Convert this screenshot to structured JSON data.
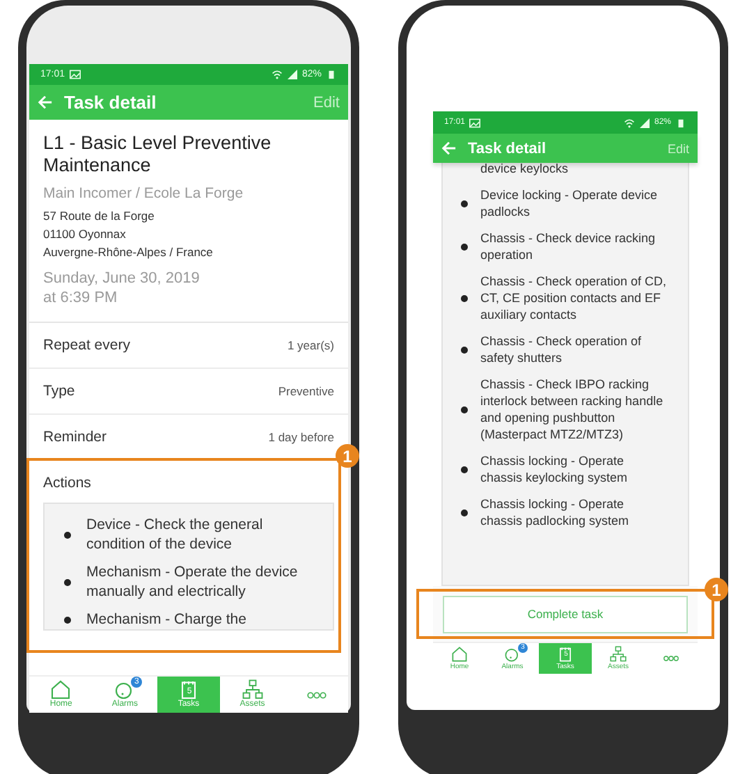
{
  "phones": [
    {
      "status_bar": {
        "time": "17:01",
        "battery": "82%"
      },
      "header": {
        "title": "Task detail",
        "action": "Edit"
      },
      "task": {
        "title": "L1 - Basic Level Preventive Maintenance",
        "location": "Main Incomer / Ecole La Forge",
        "address": [
          "57 Route de la Forge",
          "01100 Oyonnax",
          "Auvergne-Rhône-Alpes / France"
        ],
        "date": [
          "Sunday, June 30, 2019",
          "at 6:39 PM"
        ]
      },
      "details": [
        {
          "label": "Repeat every",
          "value": "1 year(s)"
        },
        {
          "label": "Type",
          "value": "Preventive"
        },
        {
          "label": "Reminder",
          "value": "1 day before"
        }
      ],
      "actions": {
        "title": "Actions",
        "items": [
          {
            "kind": "item",
            "text": "Device - Check the general condition of the device"
          },
          {
            "kind": "item",
            "text": "Mechanism - Operate the device manually and electrically"
          },
          {
            "kind": "item",
            "text": "Mechanism - Charge the"
          }
        ]
      },
      "nav": [
        {
          "kind": "home",
          "label": "Home",
          "selected": false
        },
        {
          "kind": "alarms",
          "label": "Alarms",
          "badge": "3",
          "selected": false
        },
        {
          "kind": "tasks",
          "label": "Tasks",
          "badge": "5",
          "selected": true
        },
        {
          "kind": "assets",
          "label": "Assets",
          "selected": false
        },
        {
          "kind": "more",
          "selected": false
        }
      ],
      "callout": {
        "label": "1"
      }
    },
    {
      "status_bar": {
        "time": "17:01",
        "battery": "82%"
      },
      "header": {
        "title": "Task detail",
        "action": "Edit"
      },
      "actions": {
        "items": [
          {
            "kind": "continuation",
            "text": "device keylocks"
          },
          {
            "kind": "item",
            "text": "Device locking - Operate device padlocks"
          },
          {
            "kind": "item",
            "text": "Chassis - Check device racking operation"
          },
          {
            "kind": "item",
            "text": "Chassis - Check operation of CD, CT, CE position contacts and EF auxiliary contacts"
          },
          {
            "kind": "item",
            "text": "Chassis - Check operation of safety shutters"
          },
          {
            "kind": "item",
            "text": "Chassis - Check IBPO racking interlock between racking handle and opening pushbutton (Masterpact MTZ2/MTZ3)"
          },
          {
            "kind": "item",
            "text": "Chassis locking - Operate chassis keylocking system"
          },
          {
            "kind": "item",
            "text": "Chassis locking - Operate chassis padlocking system"
          }
        ]
      },
      "complete_button": {
        "label": "Complete task",
        "callout": {
          "label": "1"
        }
      },
      "nav": [
        {
          "kind": "home",
          "label": "Home",
          "selected": false
        },
        {
          "kind": "alarms",
          "label": "Alarms",
          "badge": "3",
          "selected": false
        },
        {
          "kind": "tasks",
          "label": "Tasks",
          "badge": "5",
          "selected": true
        },
        {
          "kind": "assets",
          "label": "Assets",
          "selected": false
        },
        {
          "kind": "more",
          "selected": false
        }
      ]
    }
  ]
}
